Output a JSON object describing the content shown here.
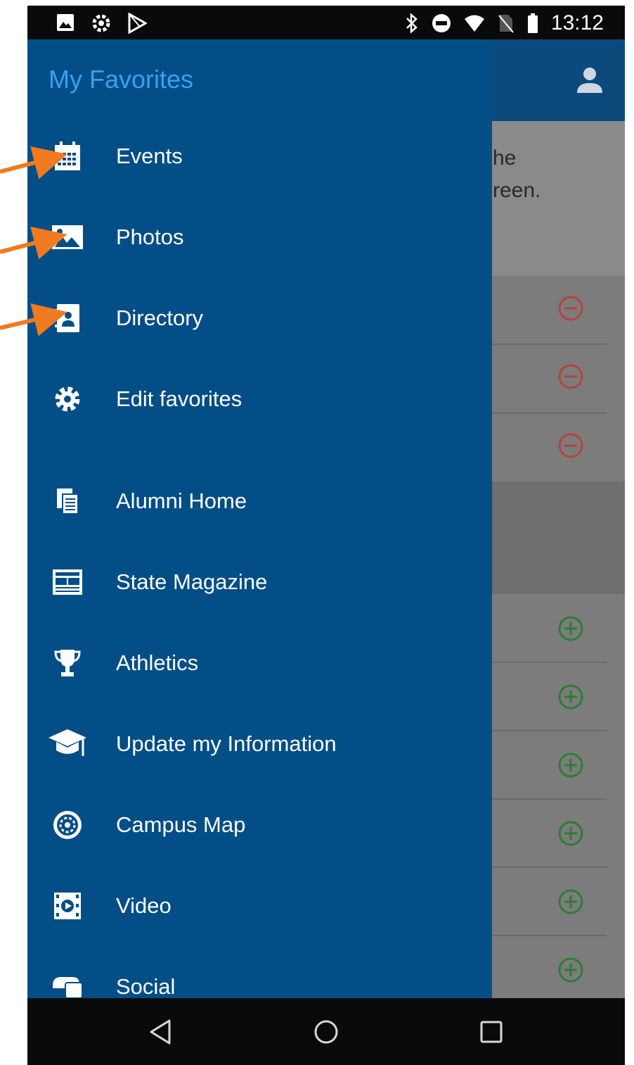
{
  "status_bar": {
    "time": "13:12",
    "left_icons": [
      "image-icon",
      "settings-gear-icon",
      "play-store-icon"
    ],
    "right_icons": [
      "bluetooth-icon",
      "do-not-disturb-icon",
      "wifi-icon",
      "no-sim-icon",
      "battery-icon"
    ]
  },
  "drawer": {
    "title": "My Favorites",
    "favorites": [
      {
        "label": "Events",
        "icon": "calendar-icon"
      },
      {
        "label": "Photos",
        "icon": "photo-icon"
      },
      {
        "label": "Directory",
        "icon": "contact-card-icon"
      },
      {
        "label": "Edit favorites",
        "icon": "gear-icon"
      }
    ],
    "items": [
      {
        "label": "Alumni Home",
        "icon": "documents-icon"
      },
      {
        "label": "State Magazine",
        "icon": "newspaper-icon"
      },
      {
        "label": "Athletics",
        "icon": "trophy-icon"
      },
      {
        "label": "Update my Information",
        "icon": "graduation-cap-icon"
      },
      {
        "label": "Campus Map",
        "icon": "compass-icon"
      },
      {
        "label": "Video",
        "icon": "video-icon"
      },
      {
        "label": "Social",
        "icon": "social-icon"
      }
    ]
  },
  "background_app": {
    "note_line1": "he",
    "note_line2": "reen.",
    "remove_color": "#c0392b",
    "add_color": "#2e7d32"
  },
  "colors": {
    "drawer_bg": "#034e87",
    "title_color": "#3aa0ef",
    "annotation_arrow": "#f07a1f"
  }
}
